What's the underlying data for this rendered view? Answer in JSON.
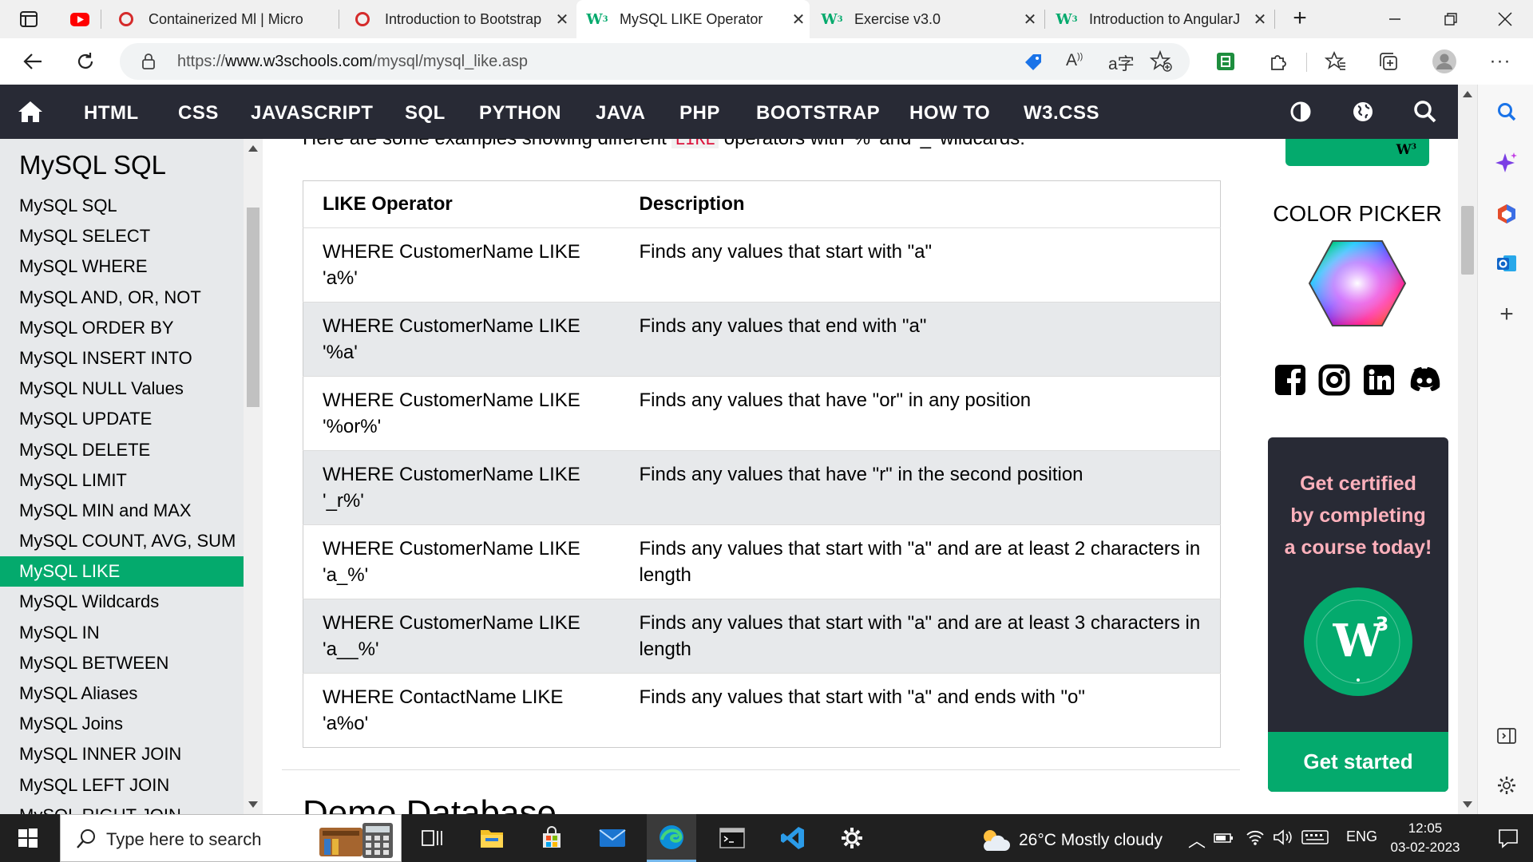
{
  "browser": {
    "tabs": [
      {
        "title": "Containerized Ml | Micro",
        "favicon": "opera-icon",
        "active": false
      },
      {
        "title": "Introduction to Bootstrap",
        "favicon": "opera-icon",
        "active": false
      },
      {
        "title": "MySQL LIKE Operator",
        "favicon": "w3schools-icon",
        "active": true
      },
      {
        "title": "Exercise v3.0",
        "favicon": "w3schools-icon",
        "active": false
      },
      {
        "title": "Introduction to AngularJ",
        "favicon": "w3schools-icon",
        "active": false
      }
    ],
    "url_prefix": "https://",
    "url_host": "www.w3schools.com",
    "url_path": "/mysql/mysql_like.asp"
  },
  "w3nav": {
    "items": [
      "HTML",
      "CSS",
      "JAVASCRIPT",
      "SQL",
      "PYTHON",
      "JAVA",
      "PHP",
      "BOOTSTRAP",
      "HOW TO",
      "W3.CSS"
    ]
  },
  "sidebar": {
    "title": "MySQL SQL",
    "items": [
      "MySQL SQL",
      "MySQL SELECT",
      "MySQL WHERE",
      "MySQL AND, OR, NOT",
      "MySQL ORDER BY",
      "MySQL INSERT INTO",
      "MySQL NULL Values",
      "MySQL UPDATE",
      "MySQL DELETE",
      "MySQL LIMIT",
      "MySQL MIN and MAX",
      "MySQL COUNT, AVG, SUM",
      "MySQL LIKE",
      "MySQL Wildcards",
      "MySQL IN",
      "MySQL BETWEEN",
      "MySQL Aliases",
      "MySQL Joins",
      "MySQL INNER JOIN",
      "MySQL LEFT JOIN",
      "MySQL RIGHT JOIN"
    ],
    "active_index": 12
  },
  "main": {
    "intro_before": "Here are some examples showing different ",
    "intro_code": "LIKE",
    "intro_after": " operators with '%' and '_' wildcards:",
    "table": {
      "headers": [
        "LIKE Operator",
        "Description"
      ],
      "rows": [
        [
          "WHERE CustomerName LIKE 'a%'",
          "Finds any values that start with \"a\""
        ],
        [
          "WHERE CustomerName LIKE '%a'",
          "Finds any values that end with \"a\""
        ],
        [
          "WHERE CustomerName LIKE '%or%'",
          "Finds any values that have \"or\" in any position"
        ],
        [
          "WHERE CustomerName LIKE '_r%'",
          "Finds any values that have \"r\" in the second position"
        ],
        [
          "WHERE CustomerName LIKE 'a_%'",
          "Finds any values that start with \"a\" and are at least 2 characters in length"
        ],
        [
          "WHERE CustomerName LIKE 'a__%'",
          "Finds any values that start with \"a\" and are at least 3 characters in length"
        ],
        [
          "WHERE ContactName LIKE 'a%o'",
          "Finds any values that start with \"a\" and ends with \"o\""
        ]
      ]
    },
    "next_heading": "Demo Database"
  },
  "rightcol": {
    "color_picker_label": "COLOR PICKER",
    "cert_lines": [
      "Get certified",
      "by completing",
      "a course today!"
    ],
    "get_started": "Get started"
  },
  "taskbar": {
    "search_placeholder": "Type here to search",
    "weather": "26°C  Mostly cloudy",
    "language": "ENG",
    "time": "12:05",
    "date": "03-02-2023"
  },
  "colors": {
    "w3_green": "#04aa6d",
    "w3_dark": "#282a35",
    "sidebar_bg": "#e7e9eb",
    "cert_text": "#ffb1bc",
    "code_red": "#dc143c"
  }
}
